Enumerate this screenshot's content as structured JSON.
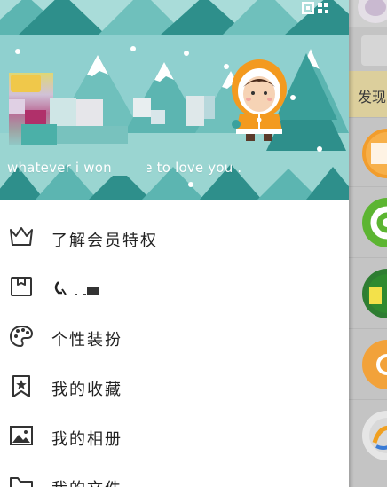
{
  "profile": {
    "signature": "whatever i won ·    tate to love you ."
  },
  "menu": {
    "items": [
      {
        "label": "了解会员特权",
        "icon": "crown-icon"
      },
      {
        "label": "",
        "icon": "wallet-icon"
      },
      {
        "label": "个性装扮",
        "icon": "palette-icon"
      },
      {
        "label": "我的收藏",
        "icon": "bookmark-star-icon"
      },
      {
        "label": "我的相册",
        "icon": "photo-icon"
      },
      {
        "label": "我的文件",
        "icon": "folder-icon"
      }
    ]
  },
  "background_page": {
    "discover_tab": "发现"
  },
  "colors": {
    "banner_sky": "#8fd0cf",
    "tree_dark": "#2e8f8b",
    "tree_light": "#5cb5b1",
    "menu_text": "#222222",
    "icon_stroke": "#333333"
  }
}
